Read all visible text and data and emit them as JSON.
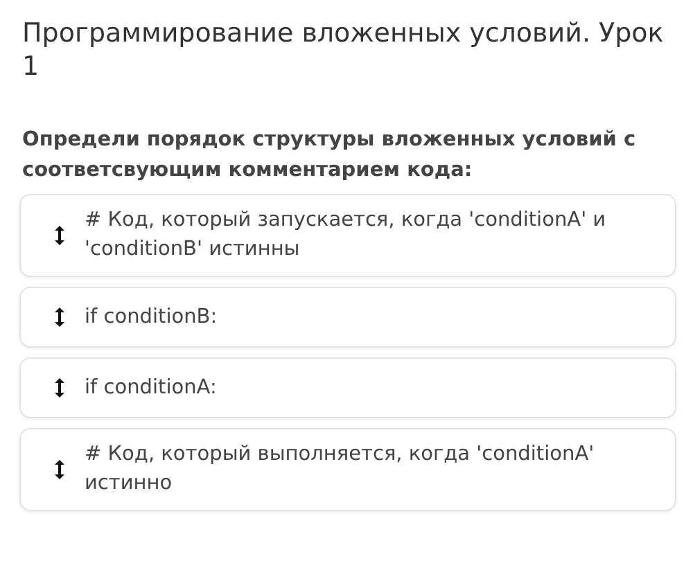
{
  "title": "Программирование вложенных условий. Урок 1",
  "question": "Определи порядок структуры вложенных условий с соответсвующим комментарием кода:",
  "items": [
    {
      "text": "# Код, который запускается, когда 'conditionA' и 'conditionB' истинны"
    },
    {
      "text": "if conditionB:"
    },
    {
      "text": "if conditionA:"
    },
    {
      "text": "# Код, который выполняется, когда 'conditionA' истинно"
    }
  ]
}
